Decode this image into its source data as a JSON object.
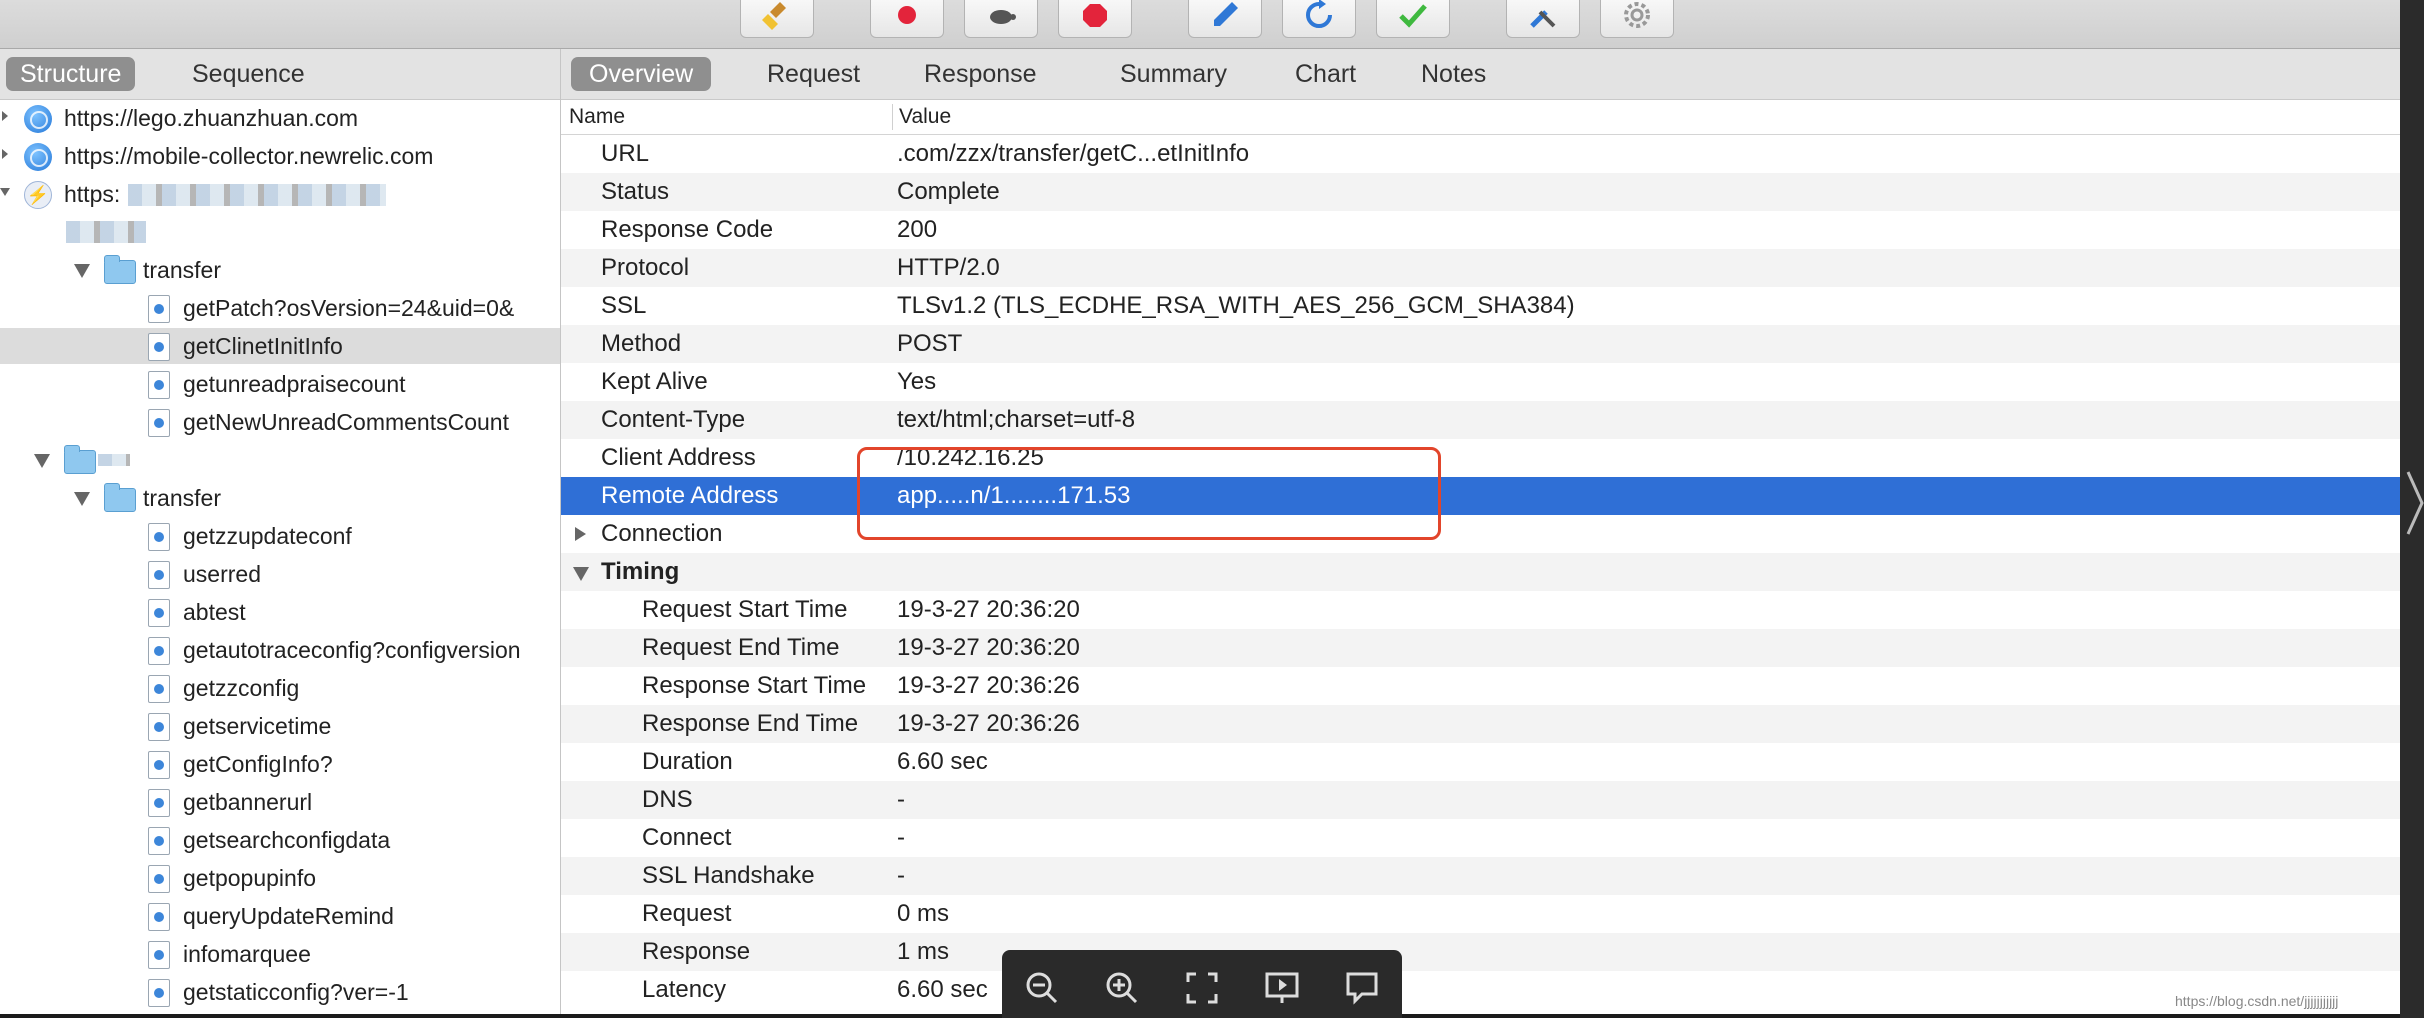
{
  "toolbar": {
    "buttons": [
      {
        "name": "broom-icon"
      },
      {
        "name": "record-icon"
      },
      {
        "name": "turtle-icon"
      },
      {
        "name": "stop-icon"
      },
      {
        "name": "pen-icon"
      },
      {
        "name": "refresh-icon"
      },
      {
        "name": "check-icon"
      },
      {
        "name": "tools-icon"
      },
      {
        "name": "settings-icon"
      }
    ]
  },
  "left": {
    "tabs": [
      "Structure",
      "Sequence"
    ],
    "active_tab": "Structure",
    "tree": [
      {
        "label": "https://lego.zhuanzhuan.com",
        "icon": "globe"
      },
      {
        "label": "https://mobile-collector.newrelic.com",
        "icon": "globe"
      },
      {
        "label": "https:",
        "icon": "bolt"
      },
      {
        "label": "",
        "icon": "folder"
      },
      {
        "label": "transfer",
        "icon": "folder"
      },
      {
        "label": "getPatch?osVersion=24&uid=0&",
        "icon": "file"
      },
      {
        "label": "getClinetInitInfo",
        "icon": "file",
        "selected": true
      },
      {
        "label": "getunreadpraisecount",
        "icon": "file"
      },
      {
        "label": "getNewUnreadCommentsCount",
        "icon": "file"
      },
      {
        "label": "",
        "icon": "folder"
      },
      {
        "label": "transfer",
        "icon": "folder"
      },
      {
        "label": "getzzupdateconf",
        "icon": "file"
      },
      {
        "label": "userred",
        "icon": "file"
      },
      {
        "label": "abtest",
        "icon": "file"
      },
      {
        "label": "getautotraceconfig?configversion",
        "icon": "file"
      },
      {
        "label": "getzzconfig",
        "icon": "file"
      },
      {
        "label": "getservicetime",
        "icon": "file"
      },
      {
        "label": "getConfigInfo?",
        "icon": "file"
      },
      {
        "label": "getbannerurl",
        "icon": "file"
      },
      {
        "label": "getsearchconfigdata",
        "icon": "file"
      },
      {
        "label": "getpopupinfo",
        "icon": "file"
      },
      {
        "label": "queryUpdateRemind",
        "icon": "file"
      },
      {
        "label": "infomarquee",
        "icon": "file"
      },
      {
        "label": "getstaticconfig?ver=-1",
        "icon": "file"
      }
    ]
  },
  "right": {
    "tabs": [
      "Overview",
      "Request",
      "Response",
      "Summary",
      "Chart",
      "Notes"
    ],
    "active_tab": "Overview",
    "columns": {
      "name": "Name",
      "value": "Value"
    },
    "rows": [
      {
        "name": "URL",
        "value": ".com/zzx/transfer/getC...etInitInfo"
      },
      {
        "name": "Status",
        "value": "Complete"
      },
      {
        "name": "Response Code",
        "value": "200"
      },
      {
        "name": "Protocol",
        "value": "HTTP/2.0"
      },
      {
        "name": "SSL",
        "value": "TLSv1.2 (TLS_ECDHE_RSA_WITH_AES_256_GCM_SHA384)"
      },
      {
        "name": "Method",
        "value": "POST"
      },
      {
        "name": "Kept Alive",
        "value": "Yes"
      },
      {
        "name": "Content-Type",
        "value": "text/html;charset=utf-8"
      },
      {
        "name": "Client Address",
        "value": "/10.242.16.25"
      },
      {
        "name": "Remote Address",
        "value": "app.....n/1........171.53",
        "selected": true
      },
      {
        "name": "Connection",
        "value": "",
        "collapsed": true
      },
      {
        "name": "Timing",
        "value": "",
        "expanded": true
      },
      {
        "name": "Request Start Time",
        "value": "19-3-27 20:36:20",
        "sub": true
      },
      {
        "name": "Request End Time",
        "value": "19-3-27 20:36:20",
        "sub": true
      },
      {
        "name": "Response Start Time",
        "value": "19-3-27 20:36:26",
        "sub": true
      },
      {
        "name": "Response End Time",
        "value": "19-3-27 20:36:26",
        "sub": true
      },
      {
        "name": "Duration",
        "value": "6.60 sec",
        "sub": true
      },
      {
        "name": "DNS",
        "value": "-",
        "sub": true
      },
      {
        "name": "Connect",
        "value": "-",
        "sub": true
      },
      {
        "name": "SSL Handshake",
        "value": "-",
        "sub": true
      },
      {
        "name": "Request",
        "value": "0 ms",
        "sub": true
      },
      {
        "name": "Response",
        "value": "1 ms",
        "sub": true
      },
      {
        "name": "Latency",
        "value": "6.60 sec",
        "sub": true
      }
    ]
  },
  "viewer_bar": {
    "buttons": [
      "zoom-out-icon",
      "zoom-in-icon",
      "fullscreen-icon",
      "slideshow-icon",
      "comment-icon"
    ]
  },
  "watermark": "https://blog.csdn.net/jjjjjjjjjjj"
}
